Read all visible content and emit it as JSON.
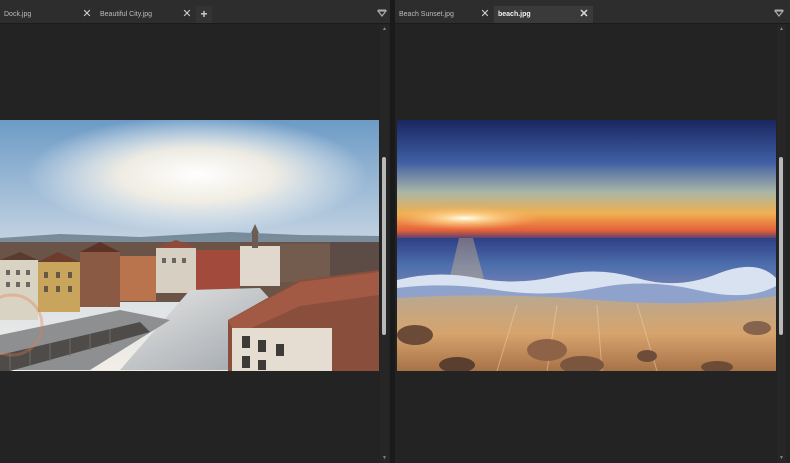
{
  "left_pane": {
    "tabs": [
      {
        "label": "Dock.jpg",
        "active": false
      },
      {
        "label": "Beautiful City.jpg",
        "active": false
      }
    ],
    "close_glyph": "✕",
    "new_tab_glyph": "+",
    "image": {
      "name": "city-photo",
      "colors": {
        "sky": "#7aa3c8",
        "sun": "#fff7e8",
        "roof": "#7b4a3a",
        "street": "#bfc3c6"
      }
    }
  },
  "right_pane": {
    "tabs": [
      {
        "label": "Beach Sunset.jpg",
        "active": false
      },
      {
        "label": "beach.jpg",
        "active": true
      }
    ],
    "close_glyph": "✕",
    "image": {
      "name": "beach-photo",
      "colors": {
        "sky_top": "#1c2a66",
        "horizon": "#f0a040",
        "sea": "#3f5f9e",
        "sand": "#c89a6a"
      }
    }
  },
  "icons": {
    "tab_menu": "chevron-down-icon",
    "scroll_up": "scroll-up-arrow",
    "scroll_down": "scroll-down-arrow"
  },
  "theme": {
    "background": "#232323",
    "tabbar": "#2d2d2d",
    "active_tab": "#3a3a3a"
  }
}
